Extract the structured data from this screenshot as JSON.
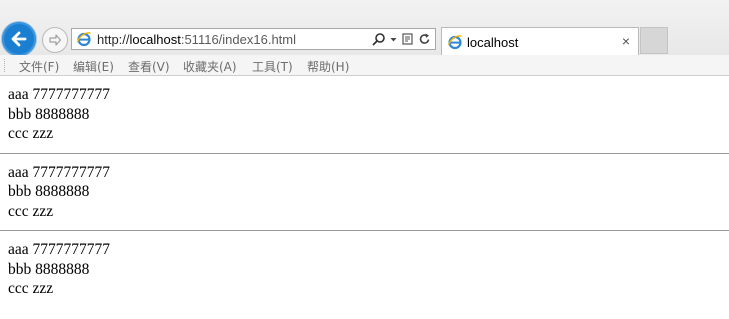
{
  "browser": {
    "url_prefix": "http://",
    "url_host": "localhost",
    "url_rest": ":51116/index16.html",
    "tab_title": "localhost",
    "tab_close_glyph": "×",
    "accent_color": "#1b7fd1"
  },
  "menu": {
    "items": [
      {
        "label": "文件(F)"
      },
      {
        "label": "编辑(E)"
      },
      {
        "label": "查看(V)"
      },
      {
        "label": "收藏夹(A)"
      },
      {
        "label": "工具(T)"
      },
      {
        "label": "帮助(H)"
      }
    ]
  },
  "page": {
    "blocks": [
      {
        "lines": [
          "aaa 7777777777",
          "bbb 8888888",
          "ccc zzz"
        ]
      },
      {
        "lines": [
          "aaa 7777777777",
          "bbb 8888888",
          "ccc zzz"
        ]
      },
      {
        "lines": [
          "aaa 7777777777",
          "bbb 8888888",
          "ccc zzz"
        ]
      }
    ]
  }
}
